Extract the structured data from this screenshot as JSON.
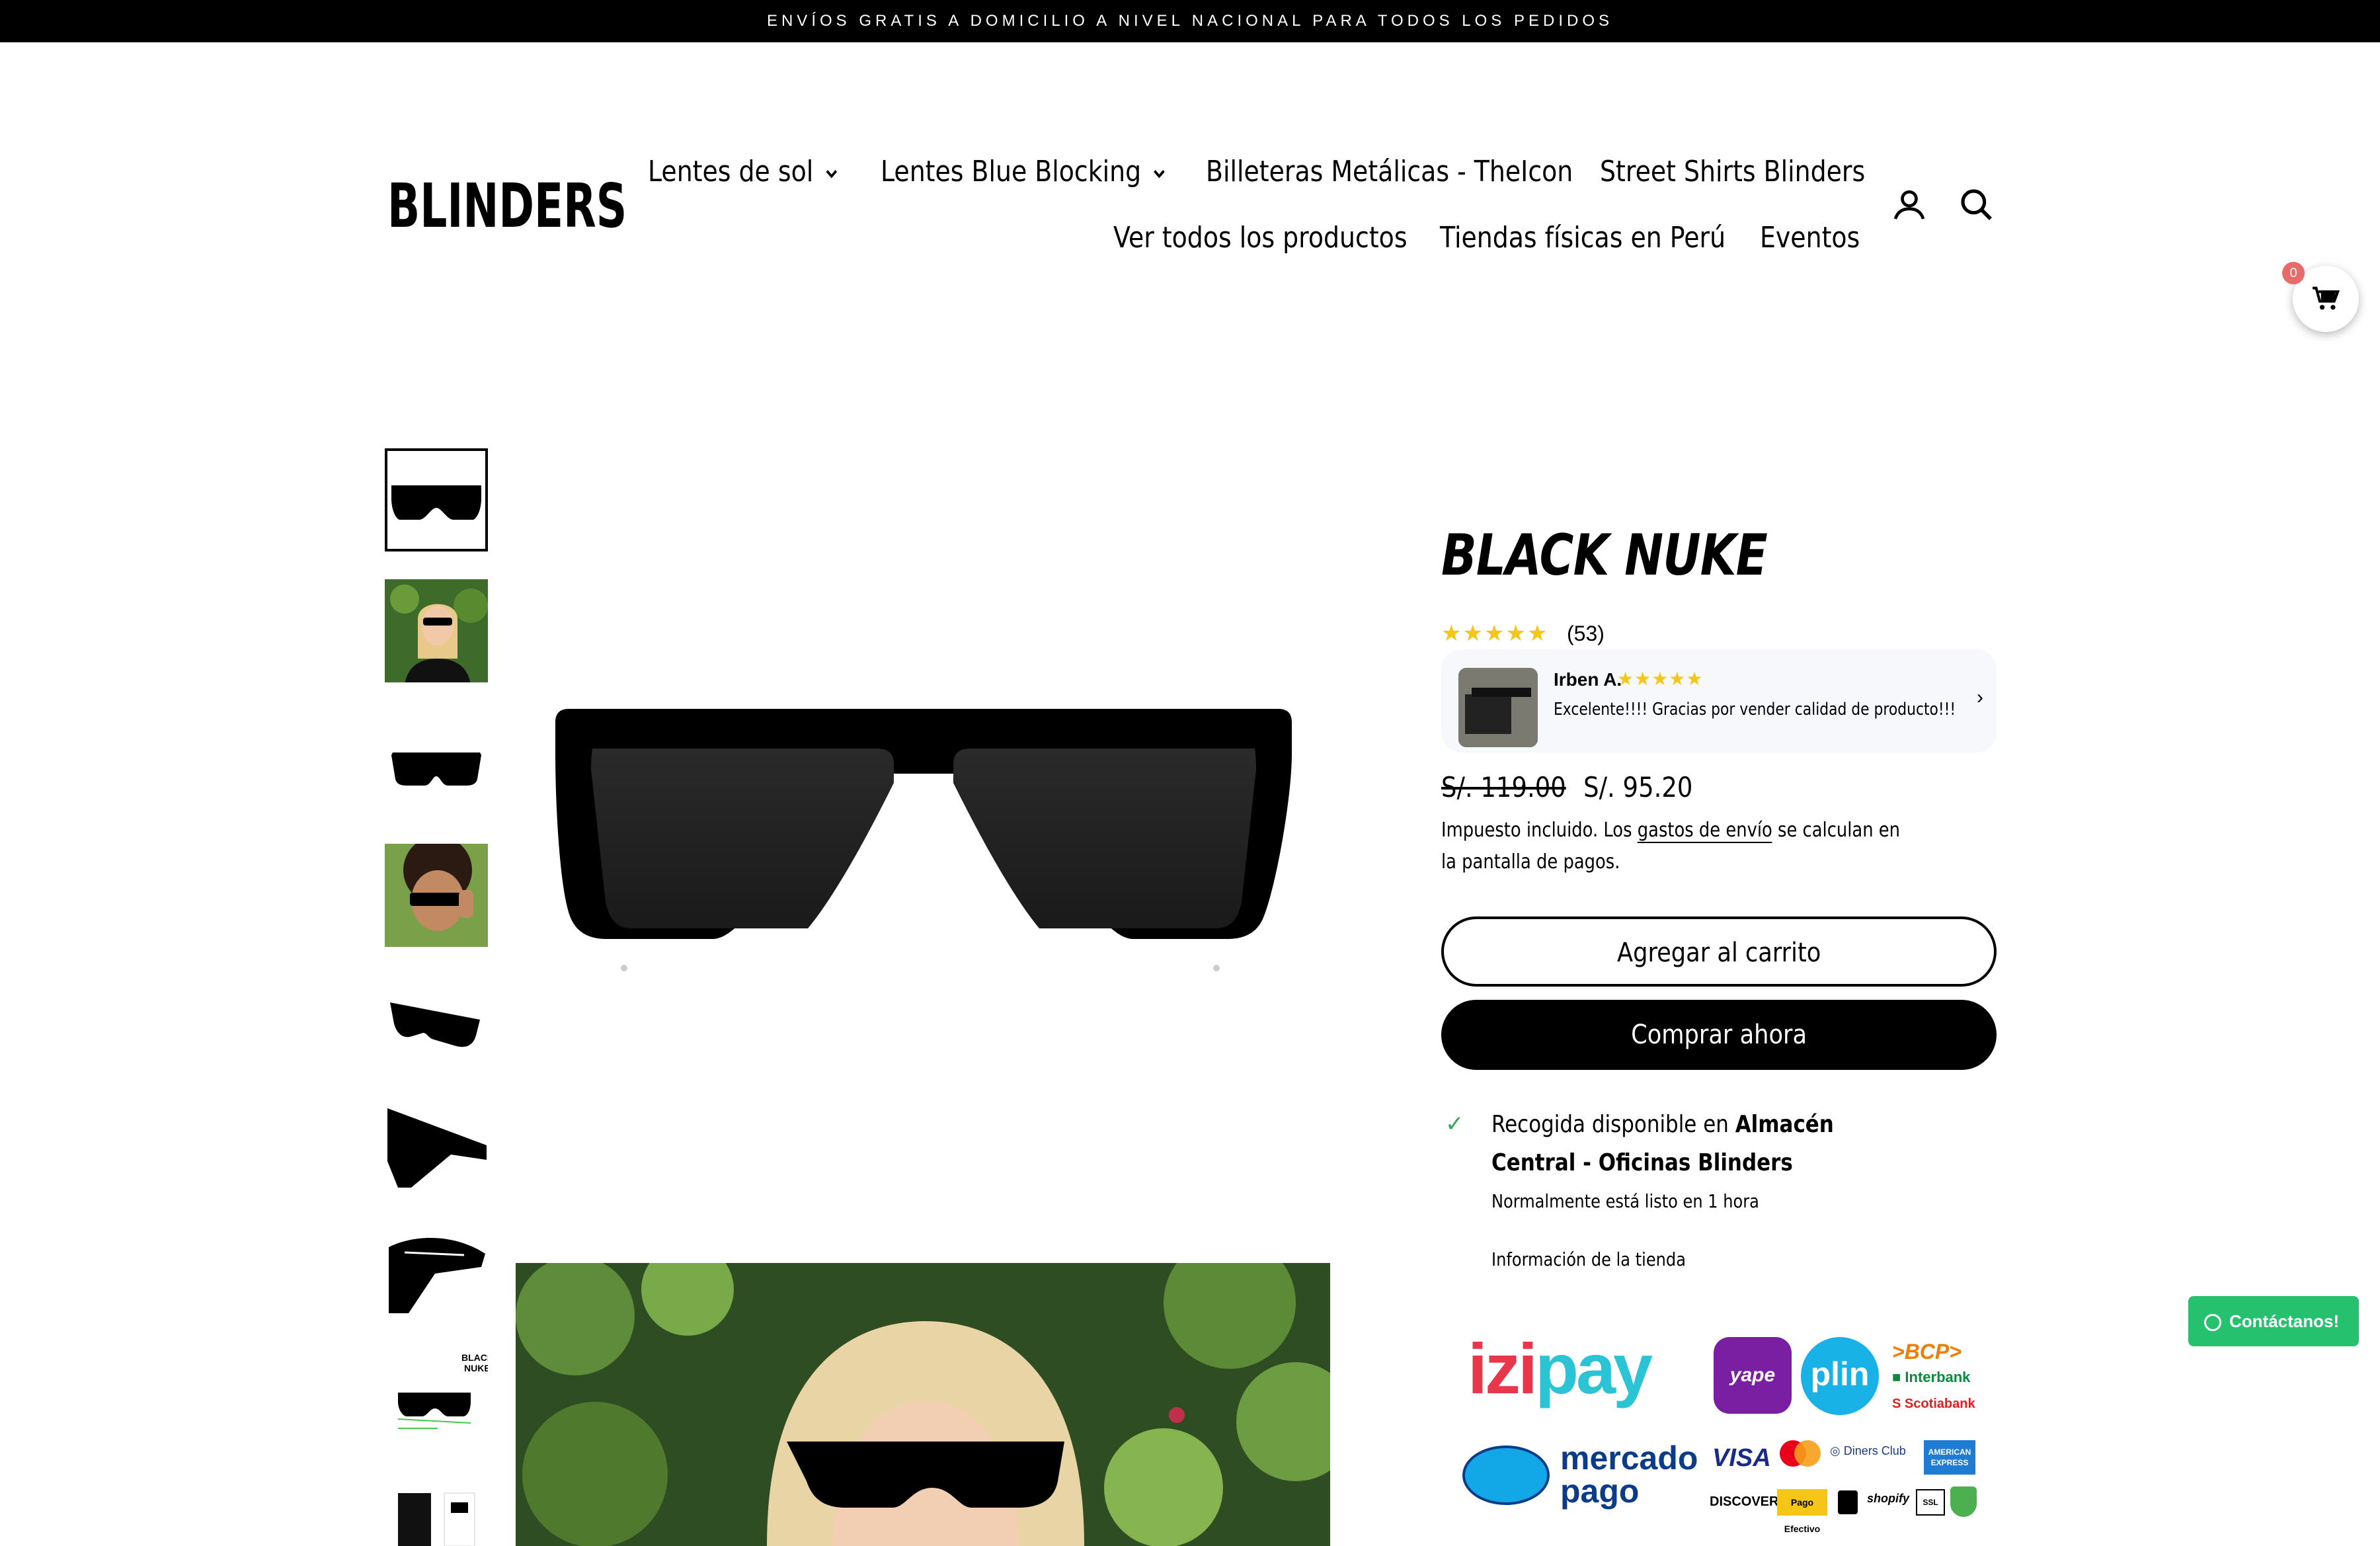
{
  "announcement": "ENVÍOS GRATIS A DOMICILIO A NIVEL NACIONAL PARA TODOS LOS PEDIDOS",
  "brand": "BLINDERS",
  "nav": {
    "row1": [
      "Lentes de sol",
      "Lentes Blue Blocking",
      "Billeteras Metálicas - TheIcon",
      "Street Shirts Blinders"
    ],
    "row2": [
      "Ver todos los productos",
      "Tiendas físicas en Perú",
      "Eventos"
    ]
  },
  "cart_count": "0",
  "product": {
    "title": "BLACK NUKE",
    "review_count": "(53)",
    "old_price": "S/. 119.00",
    "price": "S/. 95.20",
    "tax_text": "Impuesto incluido. Los",
    "tax_link": "gastos de envío",
    "tax_text_end": "se calculan en la pantalla de pagos.",
    "add_to_cart": "Agregar al carrito",
    "buy_now": "Comprar ahora"
  },
  "review": {
    "name": "Irben A.",
    "text": "Excelente!!!! Gracias por vender calidad de producto!!!",
    "rating": 5
  },
  "rating": 5,
  "pickup": {
    "prefix": "Recogida disponible en",
    "location": "Almacén Central - Oficinas Blinders",
    "ready": "Normalmente está listo en 1 hora",
    "store_info": "Información de la tienda"
  },
  "whatsapp": "Contáctanos!",
  "payments": {
    "izipay": "izipay",
    "yape": "yape",
    "plin": "plin",
    "bcp": "BCP",
    "interbank": "Interbank",
    "scotiabank": "Scotiabank",
    "mercado": "mercado",
    "pago": "pago",
    "visa": "VISA",
    "mastercard": "mastercard",
    "diners": "Diners Club",
    "amex": "AMERICAN EXPRESS",
    "discover": "DISCOVER",
    "pagoefectivo": "Pago Efectivo",
    "shopify": "shopify",
    "ssl": "SSL"
  },
  "colors": {
    "accent": "#000000",
    "star": "#f5c518",
    "whatsapp": "#25c16f",
    "badge": "#e86a6a"
  }
}
